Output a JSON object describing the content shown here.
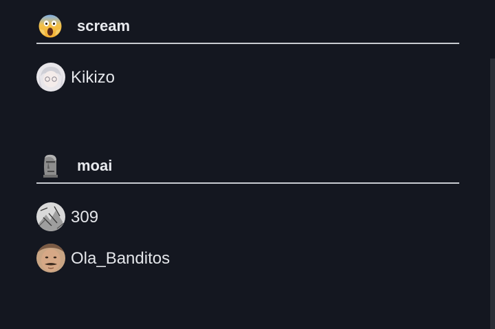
{
  "reactions": [
    {
      "emoji_icon": "face-screaming-in-fear-icon",
      "name": "scream",
      "users": [
        {
          "name": "Kikizo",
          "avatar": "anime-avatar"
        }
      ]
    },
    {
      "emoji_icon": "moai-statue-icon",
      "name": "moai",
      "users": [
        {
          "name": "309",
          "avatar": "sketch-avatar"
        },
        {
          "name": "Ola_Banditos",
          "avatar": "man-mustache-avatar"
        }
      ]
    }
  ],
  "colors": {
    "background": "#141720",
    "divider": "#c9ccd2",
    "text": "#e4e6ea"
  }
}
